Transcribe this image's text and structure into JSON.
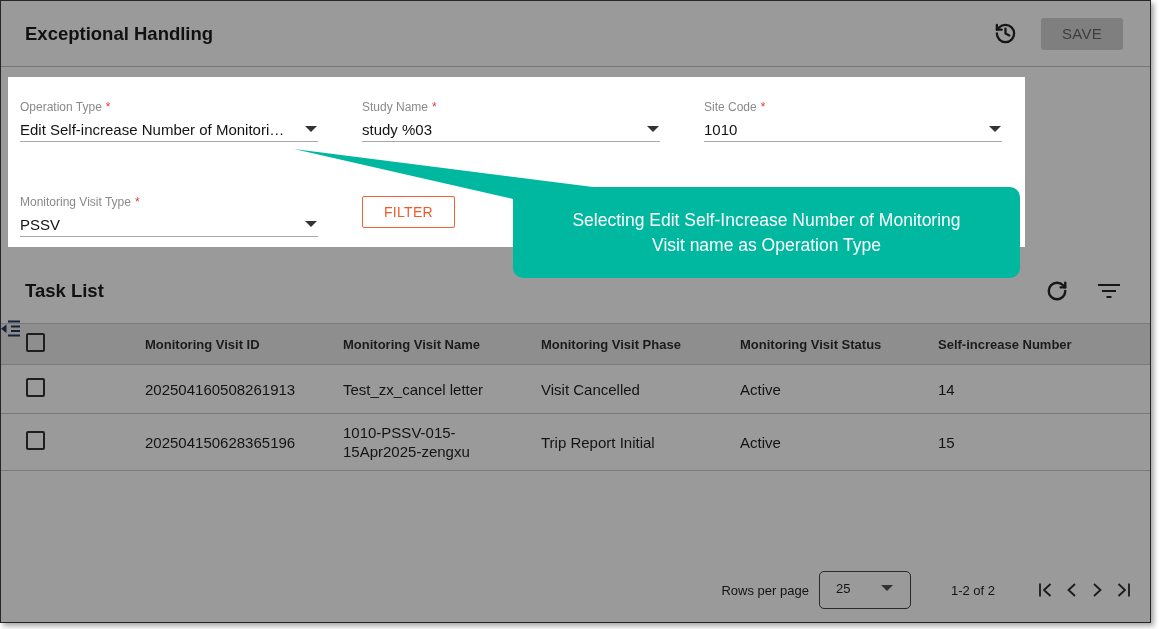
{
  "header": {
    "title": "Exceptional Handling",
    "save_button": {
      "label": "SAVE",
      "disabled": true
    }
  },
  "filters": {
    "fields": [
      {
        "label": "Operation Type",
        "required_mark": "*",
        "value": "Edit Self-increase Number of Monitori…"
      },
      {
        "label": "Study Name",
        "required_mark": "*",
        "value": "study %03"
      },
      {
        "label": "Site Code",
        "required_mark": "*",
        "value": "1010"
      },
      {
        "label": "Monitoring Visit Type",
        "required_mark": "*",
        "value": "PSSV"
      }
    ],
    "filter_button": "FILTER"
  },
  "callout": {
    "text": "Selecting Edit Self-Increase Number of Monitoring Visit name as Operation Type"
  },
  "task_list": {
    "title": "Task List",
    "select_all": {
      "checked": false
    },
    "columns": [
      "Monitoring Visit ID",
      "Monitoring Visit Name",
      "Monitoring Visit Phase",
      "Monitoring Visit Status",
      "Self-increase Number"
    ],
    "rows": [
      {
        "checked": false,
        "cells": [
          "202504160508261913",
          "Test_zx_cancel letter",
          "Visit Cancelled",
          "Active",
          "14"
        ]
      },
      {
        "checked": false,
        "cells": [
          "202504150628365196",
          "1010-PSSV-015-15Apr2025-zengxu",
          "Trip Report Initial",
          "Active",
          "15"
        ]
      }
    ]
  },
  "pagination": {
    "rows_per_page_label": "Rows per page",
    "rows_per_page": "25",
    "range": "1-2 of 2"
  }
}
